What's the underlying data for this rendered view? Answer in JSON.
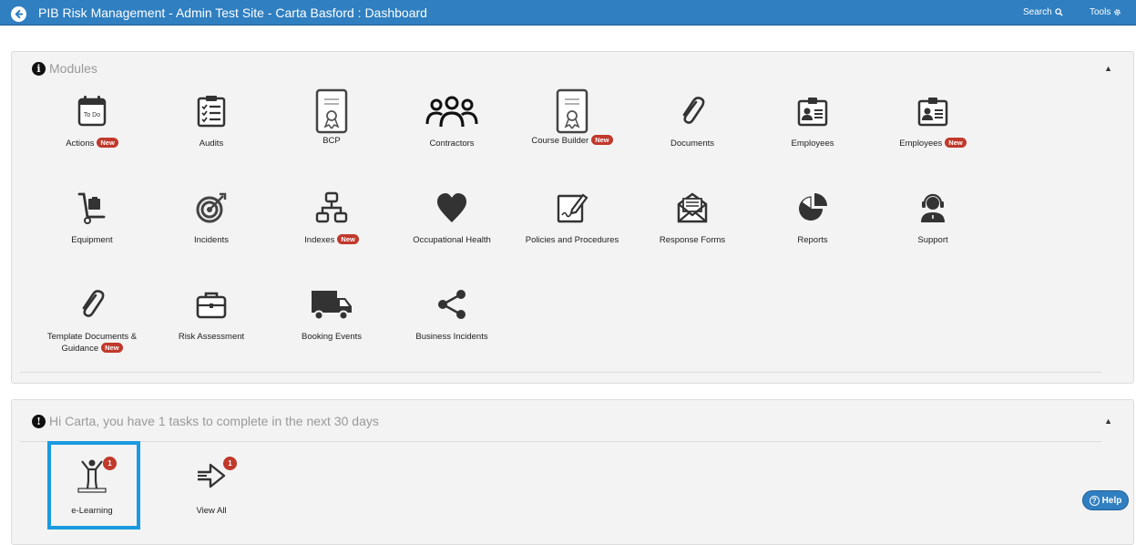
{
  "header": {
    "title": "PIB Risk Management - Admin Test Site - Carta Basford : Dashboard",
    "search_label": "Search",
    "tools_label": "Tools"
  },
  "modules": {
    "heading": "Modules",
    "items": [
      {
        "label": "Actions",
        "new": "New",
        "icon": "todo-calendar-icon"
      },
      {
        "label": "Audits",
        "new": "",
        "icon": "checklist-icon"
      },
      {
        "label": "BCP",
        "new": "",
        "icon": "certificate-icon"
      },
      {
        "label": "Contractors",
        "new": "",
        "icon": "people-group-icon"
      },
      {
        "label": "Course Builder",
        "new": "New",
        "icon": "certificate-icon"
      },
      {
        "label": "Documents",
        "new": "",
        "icon": "paperclip-icon"
      },
      {
        "label": "Employees",
        "new": "",
        "icon": "id-badge-icon"
      },
      {
        "label": "Employees",
        "new": "New",
        "icon": "id-badge-icon"
      },
      {
        "label": "Equipment",
        "new": "",
        "icon": "hand-truck-icon"
      },
      {
        "label": "Incidents",
        "new": "",
        "icon": "target-icon"
      },
      {
        "label": "Indexes",
        "new": "New",
        "icon": "sitemap-icon"
      },
      {
        "label": "Occupational Health",
        "new": "",
        "icon": "heart-icon"
      },
      {
        "label": "Policies and Procedures",
        "new": "",
        "icon": "signed-document-icon"
      },
      {
        "label": "Response Forms",
        "new": "",
        "icon": "open-envelope-icon"
      },
      {
        "label": "Reports",
        "new": "",
        "icon": "pie-chart-icon"
      },
      {
        "label": "Support",
        "new": "",
        "icon": "headset-icon"
      },
      {
        "label": "Template Documents & Guidance",
        "new": "New",
        "icon": "paperclip-icon"
      },
      {
        "label": "Risk Assessment",
        "new": "",
        "icon": "briefcase-icon"
      },
      {
        "label": "Booking Events",
        "new": "",
        "icon": "truck-icon"
      },
      {
        "label": "Business Incidents",
        "new": "",
        "icon": "share-icon"
      }
    ]
  },
  "tasks": {
    "heading": "Hi Carta, you have 1 tasks to complete in the next 30 days",
    "items": [
      {
        "label": "e-Learning",
        "count": "1",
        "icon": "podium-person-icon"
      },
      {
        "label": "View All",
        "count": "1",
        "icon": "arrow-right-icon"
      }
    ]
  },
  "help": {
    "label": "Help"
  },
  "colors": {
    "header": "#2f7fc1",
    "badge": "#c0392b",
    "highlight": "#1a9ae0"
  }
}
